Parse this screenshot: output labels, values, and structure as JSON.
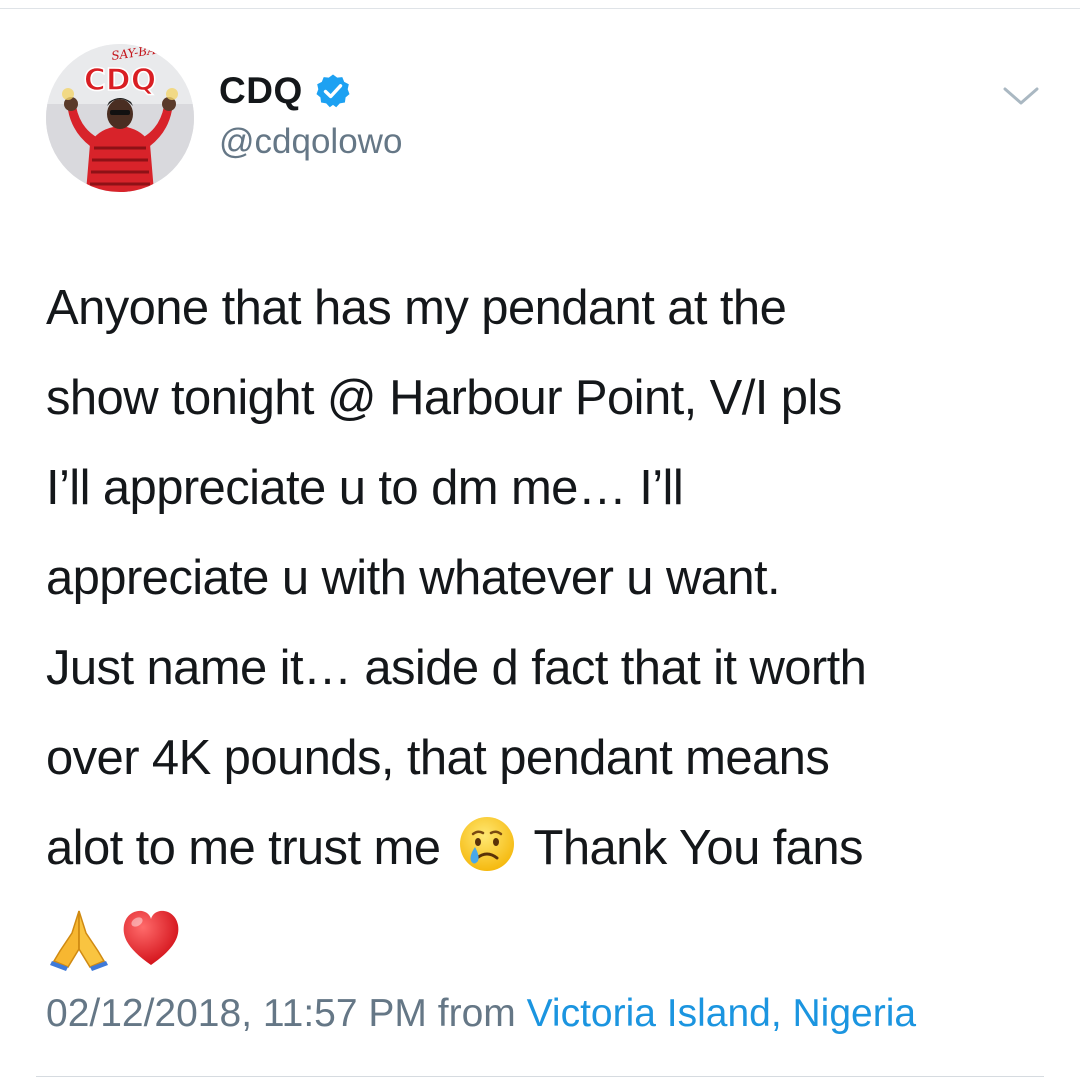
{
  "tweet": {
    "author": {
      "display_name": "CDQ",
      "handle": "@cdqolowo",
      "verified": true,
      "avatar_logo_text": "CDQ",
      "avatar_logo_subtext": "SAY-BABA"
    },
    "body_lines": [
      "Anyone that has my pendant at the",
      "show tonight @ Harbour Point, V/I pls",
      "I’ll appreciate u to dm me… I’ll",
      "appreciate u with whatever u want.",
      "Just name it… aside d fact that it worth",
      "over 4K pounds, that pendant means"
    ],
    "body_line_7_before": "alot to me trust me",
    "body_line_7_after": "Thank You fans",
    "emojis": [
      "crying-face",
      "folded-hands",
      "red-heart"
    ],
    "timestamp": "02/12/2018, 11:57 PM",
    "from_word": "from",
    "location": "Victoria Island, Nigeria"
  },
  "colors": {
    "text_primary": "#14171a",
    "text_secondary": "#657786",
    "link": "#1b95e0",
    "verified_badge": "#1da1f2"
  },
  "icons": {
    "verified": "verified-badge-icon",
    "menu": "chevron-down-icon"
  }
}
